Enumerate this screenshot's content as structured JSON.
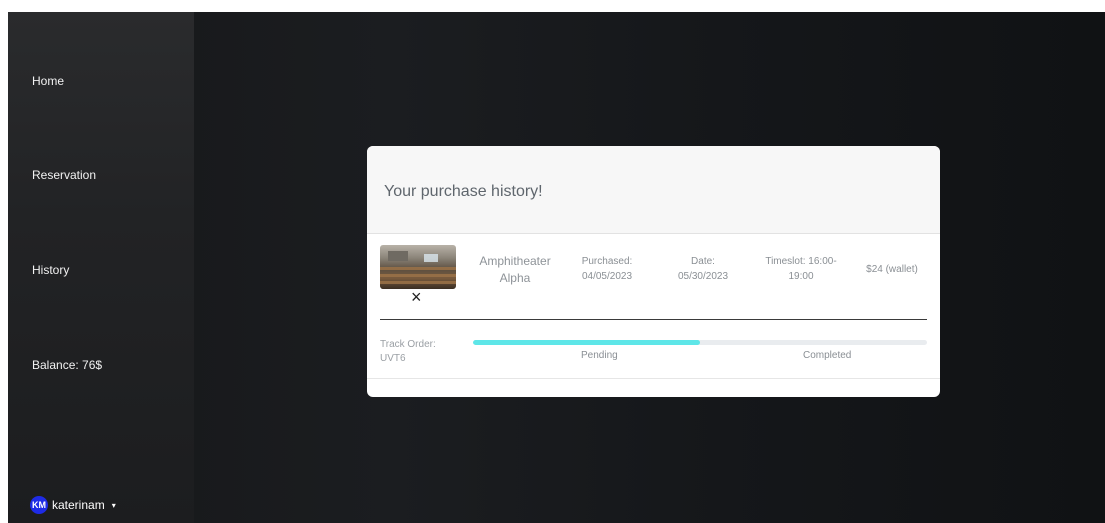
{
  "sidebar": {
    "items": [
      {
        "label": "Home"
      },
      {
        "label": "Reservation"
      },
      {
        "label": "History"
      },
      {
        "label": "Balance: 76$"
      }
    ],
    "user": {
      "initials": "KM",
      "name": "katerinam",
      "caret": "▾"
    }
  },
  "modal": {
    "title": "Your purchase history!",
    "order": {
      "room": "Amphitheater Alpha",
      "purchased_label": "Purchased:",
      "purchased": "04/05/2023",
      "date_label": "Date:",
      "date": "05/30/2023",
      "timeslot": "Timeslot: 16:00-19:00",
      "price": "$24 (wallet)",
      "remove_icon": "×",
      "track_label": "Track Order:",
      "track_code": "UVT6",
      "progress_fraction": 0.5,
      "status_pending": "Pending",
      "status_completed": "Completed"
    }
  },
  "colors": {
    "progress_fill": "#5ee6e8",
    "avatar": "#1e2be6"
  }
}
